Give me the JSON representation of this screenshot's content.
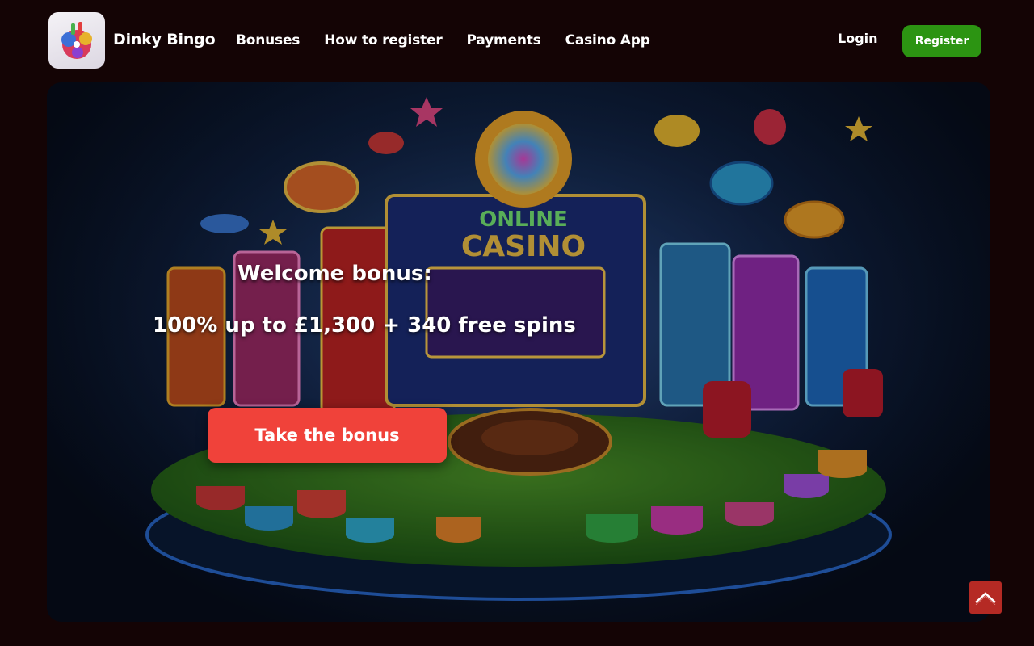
{
  "header": {
    "brand": "Dinky Bingo",
    "nav": [
      "Bonuses",
      "How to register",
      "Payments",
      "Casino App"
    ],
    "login_label": "Login",
    "register_label": "Register"
  },
  "hero": {
    "welcome_title": "Welcome bonus:",
    "offer_text": "100% up to £1,300 + 340 free spins",
    "cta_label": "Take the bonus",
    "sign_top": "ONLINE",
    "sign_main": "CASINO"
  },
  "icons": {
    "logo": "dinky-bingo-logo-icon",
    "scroll": "chevron-up-icon"
  },
  "colors": {
    "page_bg": "#140405",
    "register_bg": "#2c9412",
    "cta_bg": "#f0423a",
    "scroll_top_bg": "#b52a24"
  }
}
